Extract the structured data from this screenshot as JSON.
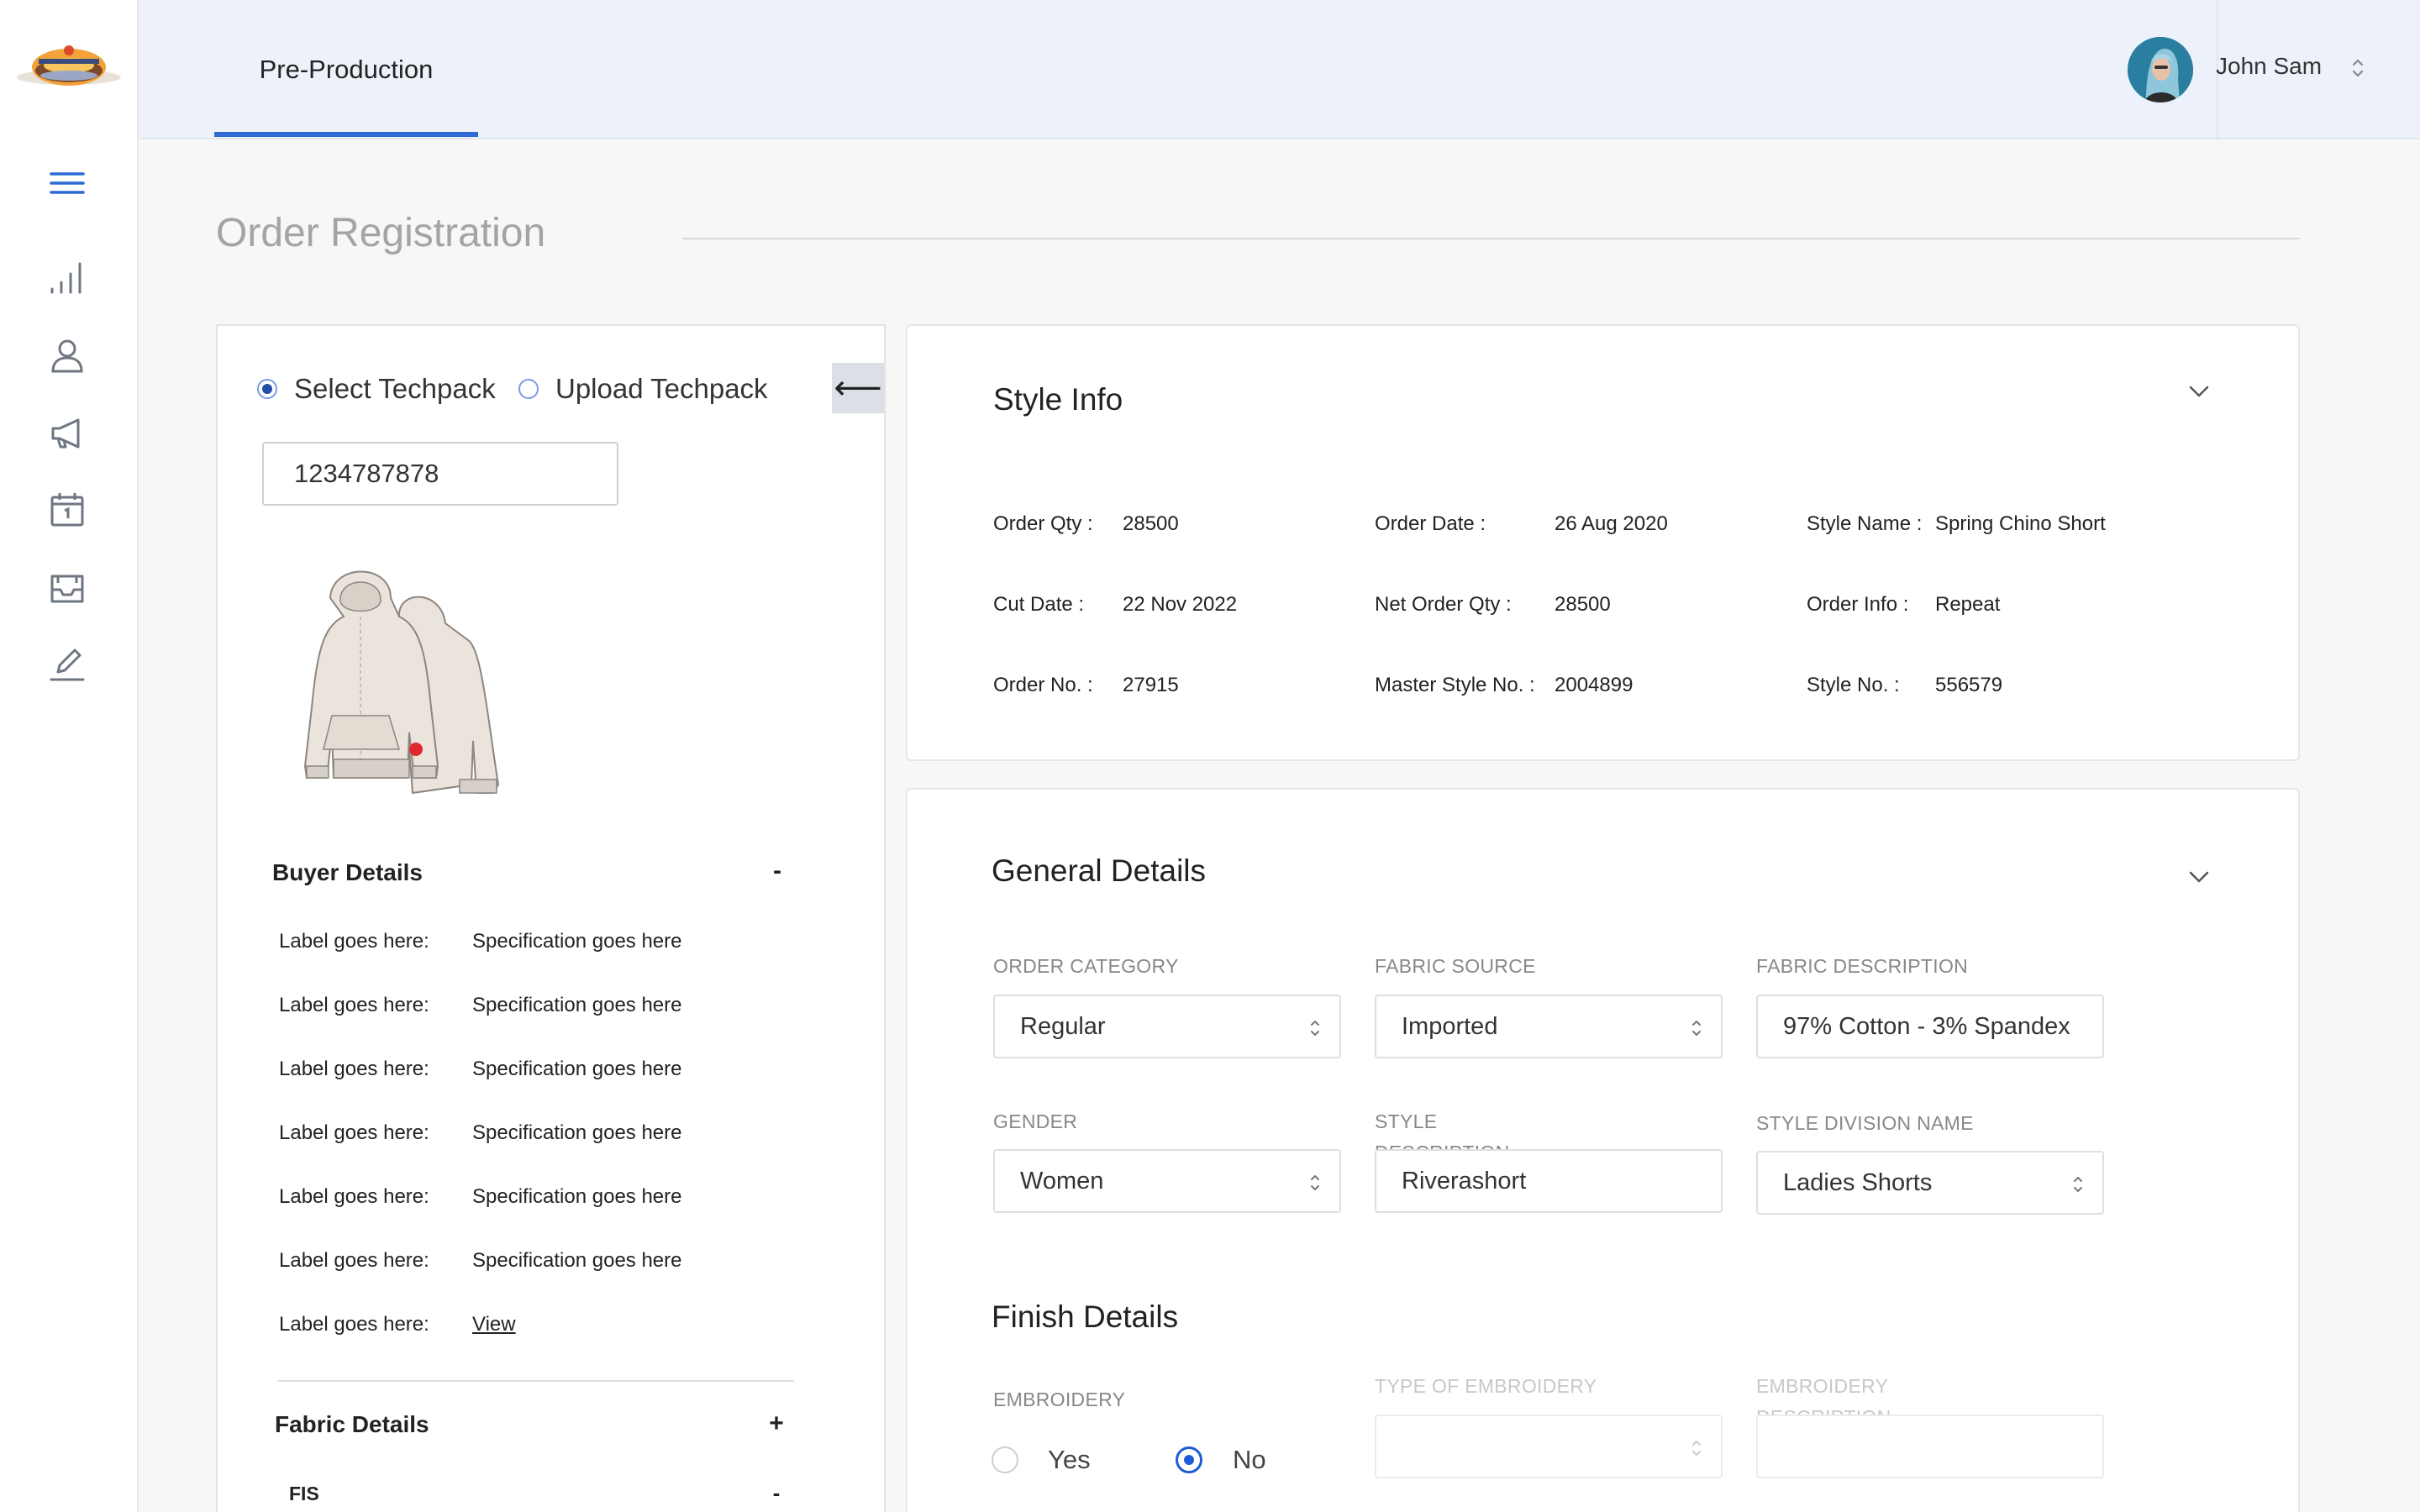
{
  "topbar": {
    "tab": "Pre-Production",
    "user_name": "John Sam"
  },
  "page_title": "Order Registration",
  "techpack": {
    "options": [
      "Select Techpack",
      "Upload Techpack"
    ],
    "selected": "Select Techpack",
    "collapse_glyph": "⟵",
    "input_value": "1234787878"
  },
  "buyer_details": {
    "title": "Buyer Details",
    "toggle": "-",
    "rows": [
      {
        "label": "Label goes here:",
        "value": "Specification goes here"
      },
      {
        "label": "Label goes here:",
        "value": "Specification goes here"
      },
      {
        "label": "Label goes here:",
        "value": "Specification goes here"
      },
      {
        "label": "Label goes here:",
        "value": "Specification goes here"
      },
      {
        "label": "Label goes here:",
        "value": "Specification goes here"
      },
      {
        "label": "Label goes here:",
        "value": "Specification goes here"
      },
      {
        "label": "Label goes here:",
        "value": "View"
      }
    ]
  },
  "fabric_details": {
    "title": "Fabric Details",
    "toggle": "+",
    "sub_item": "FIS",
    "sub_toggle": "-"
  },
  "style_info": {
    "title": "Style Info",
    "fields": [
      {
        "label": "Order Qty :",
        "value": "28500"
      },
      {
        "label": "Order Date :",
        "value": "26 Aug 2020"
      },
      {
        "label": "Style Name :",
        "value": "Spring Chino Short"
      },
      {
        "label": "Cut Date :",
        "value": "22 Nov 2022"
      },
      {
        "label": "Net Order Qty :",
        "value": "28500"
      },
      {
        "label": "Order Info :",
        "value": "Repeat"
      },
      {
        "label": "Order No. :",
        "value": "27915"
      },
      {
        "label": "Master Style No. :",
        "value": "2004899"
      },
      {
        "label": "Style No. :",
        "value": "556579"
      }
    ]
  },
  "general_details": {
    "title": "General Details",
    "order_category": {
      "label": "Order Category",
      "value": "Regular"
    },
    "fabric_source": {
      "label": "Fabric Source",
      "value": "Imported"
    },
    "fabric_description": {
      "label": "Fabric Description",
      "value": "97% Cotton - 3% Spandex"
    },
    "gender": {
      "label": "Gender",
      "value": "Women"
    },
    "style_description": {
      "label": "Style Description",
      "value": "Riverashort"
    },
    "style_division": {
      "label": "Style Division Name",
      "value": "Ladies Shorts"
    }
  },
  "finish_details": {
    "title": "Finish Details",
    "embroidery": {
      "label": "Embroidery",
      "options": [
        "Yes",
        "No"
      ],
      "selected": "No"
    },
    "type_of_embroidery": {
      "label": "Type of Embroidery",
      "value": ""
    },
    "embroidery_description": {
      "label": "Embroidery Description",
      "value": ""
    }
  },
  "icons": {
    "sidebar": [
      "menu-icon",
      "bar-chart-icon",
      "user-icon",
      "megaphone-icon",
      "calendar-icon",
      "inbox-icon",
      "edit-icon"
    ],
    "accent": "#2d6ad6"
  }
}
